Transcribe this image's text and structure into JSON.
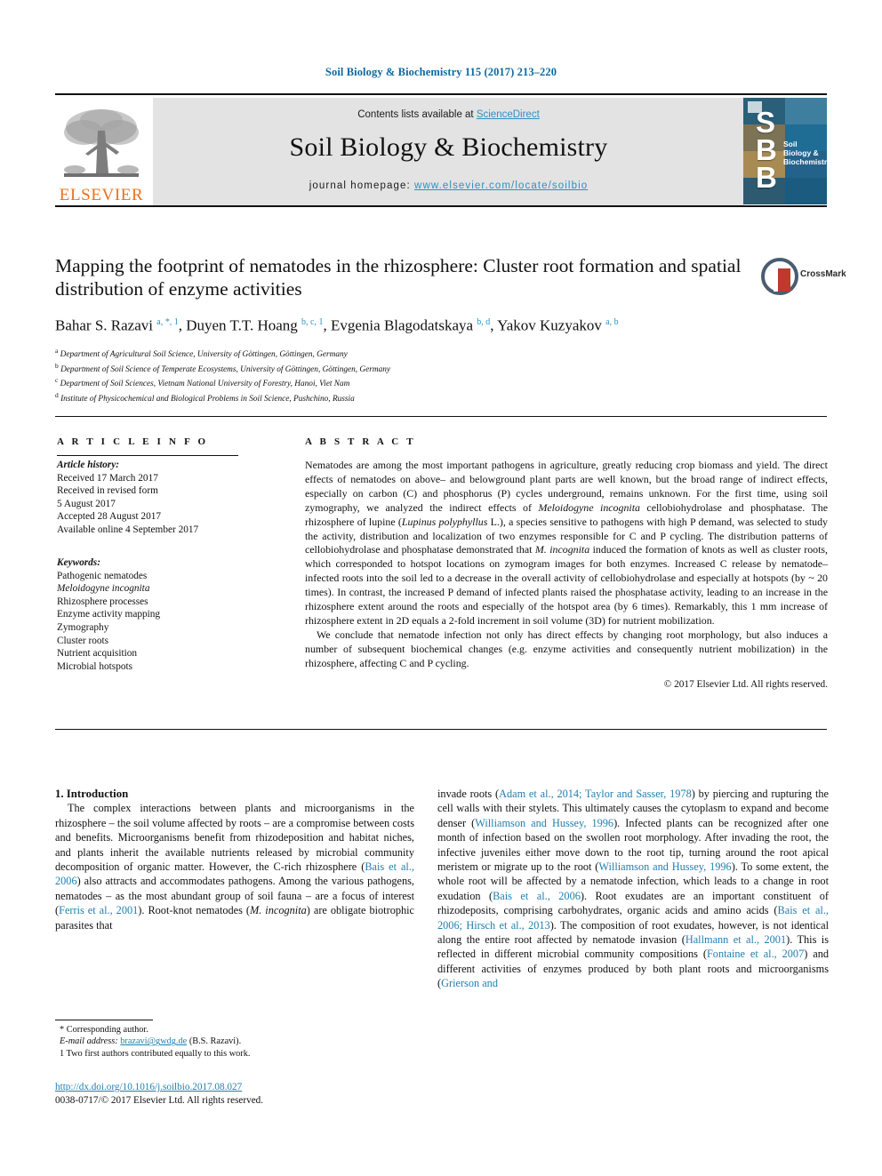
{
  "running_head": "Soil Biology & Biochemistry 115 (2017) 213–220",
  "masthead": {
    "contents_prefix": "Contents lists available at ",
    "sciencedirect": "ScienceDirect",
    "journal_title": "Soil Biology & Biochemistry",
    "homepage_label": "journal homepage: ",
    "homepage_url": "www.elsevier.com/locate/soilbio",
    "publisher": "ELSEVIER",
    "cover_initials": "S\nB\nB",
    "cover_name": "Soil Biology & Biochemistry",
    "accent_link_color": "#2e8fc4",
    "publisher_color": "#e9711c",
    "cover_bg_color": "#1d74a8"
  },
  "crossmark": {
    "label": "CrossMark"
  },
  "article": {
    "title": "Mapping the footprint of nematodes in the rhizosphere: Cluster root formation and spatial distribution of enzyme activities",
    "authors_html": "Bahar S. Razavi <sup>a, *, 1</sup>, Duyen T.T. Hoang <sup>b, c, 1</sup>, Evgenia Blagodatskaya <sup>b, d</sup>, Yakov Kuzyakov <sup>a, b</sup>",
    "affiliations": [
      {
        "mark": "a",
        "text": "Department of Agricultural Soil Science, University of Göttingen, Göttingen, Germany"
      },
      {
        "mark": "b",
        "text": "Department of Soil Science of Temperate Ecosystems, University of Göttingen, Göttingen, Germany"
      },
      {
        "mark": "c",
        "text": "Department of Soil Sciences, Vietnam National University of Forestry, Hanoi, Viet Nam"
      },
      {
        "mark": "d",
        "text": "Institute of Physicochemical and Biological Problems in Soil Science, Pushchino, Russia"
      }
    ]
  },
  "article_info": {
    "heading": "A R T I C L E   I N F O",
    "history_label": "Article history:",
    "history": [
      "Received 17 March 2017",
      "Received in revised form",
      "5 August 2017",
      "Accepted 28 August 2017",
      "Available online 4 September 2017"
    ],
    "keywords_label": "Keywords:",
    "keywords": [
      "Pathogenic nematodes",
      "Meloidogyne incognita",
      "Rhizosphere processes",
      "Enzyme activity mapping",
      "Zymography",
      "Cluster roots",
      "Nutrient acquisition",
      "Microbial hotspots"
    ],
    "keywords_italic_index": 1
  },
  "abstract": {
    "heading": "A B S T R A C T",
    "paragraph_1_html": "Nematodes are among the most important pathogens in agriculture, greatly reducing crop biomass and yield. The direct effects of nematodes on above– and belowground plant parts are well known, but the broad range of indirect effects, especially on carbon (C) and phosphorus (P) cycles underground, remains unknown. For the first time, using soil zymography, we analyzed the indirect effects of <span class=\"it\">Meloidogyne incognita</span> cellobiohydrolase and phosphatase. The rhizosphere of lupine (<span class=\"it\">Lupinus polyphyllus</span> L.), a species sensitive to pathogens with high P demand, was selected to study the activity, distribution and localization of two enzymes responsible for C and P cycling. The distribution patterns of cellobiohydrolase and phosphatase demonstrated that <span class=\"it\">M. incognita</span> induced the formation of knots as well as cluster roots, which corresponded to hotspot locations on zymogram images for both enzymes. Increased C release by nematode–infected roots into the soil led to a decrease in the overall activity of cellobiohydrolase and especially at hotspots (by ~ 20 times). In contrast, the increased P demand of infected plants raised the phosphatase activity, leading to an increase in the rhizosphere extent around the roots and especially of the hotspot area (by 6 times). Remarkably, this 1 mm increase of rhizosphere extent in 2D equals a 2-fold increment in soil volume (3D) for nutrient mobilization.",
    "paragraph_2_html": "We conclude that nematode infection not only has direct effects by changing root morphology, but also induces a number of subsequent biochemical changes (e.g. enzyme activities and consequently nutrient mobilization) in the rhizosphere, affecting C and P cycling.",
    "copyright": "© 2017 Elsevier Ltd. All rights reserved."
  },
  "body": {
    "section_heading": "1. Introduction",
    "left_paragraph_html": "The complex interactions between plants and microorganisms in the rhizosphere – the soil volume affected by roots – are a compromise between costs and benefits. Microorganisms benefit from rhizodeposition and habitat niches, and plants inherit the available nutrients released by microbial community decomposition of organic matter. However, the C-rich rhizosphere (<span class=\"ref\">Bais et al., 2006</span>) also attracts and accommodates pathogens. Among the various pathogens, nematodes – as the most abundant group of soil fauna – are a focus of interest (<span class=\"ref\">Ferris et al., 2001</span>). Root-knot nematodes (<span class=\"it\">M. incognita</span>) are obligate biotrophic parasites that",
    "right_paragraph_html": "invade roots (<span class=\"ref\">Adam et al., 2014; Taylor and Sasser, 1978</span>) by piercing and rupturing the cell walls with their stylets. This ultimately causes the cytoplasm to expand and become denser (<span class=\"ref\">Williamson and Hussey, 1996</span>). Infected plants can be recognized after one month of infection based on the swollen root morphology. After invading the root, the infective juveniles either move down to the root tip, turning around the root apical meristem or migrate up to the root (<span class=\"ref\">Williamson and Hussey, 1996</span>). To some extent, the whole root will be affected by a nematode infection, which leads to a change in root exudation (<span class=\"ref\">Bais et al., 2006</span>). Root exudates are an important constituent of rhizodeposits, comprising carbohydrates, organic acids and amino acids (<span class=\"ref\">Bais et al., 2006; Hirsch et al., 2013</span>). The composition of root exudates, however, is not identical along the entire root affected by nematode invasion (<span class=\"ref\">Hallmann et al., 2001</span>). This is reflected in different microbial community compositions (<span class=\"ref\">Fontaine et al., 2007</span>) and different activities of enzymes produced by both plant roots and microorganisms (<span class=\"ref\">Grierson and</span>",
    "reference_link_color": "#1f7fb0"
  },
  "footnotes": {
    "corresponding": "* Corresponding author.",
    "email_label": "E-mail address:",
    "email": "brazavi@gwdg.de",
    "email_suffix": "(B.S. Razavi).",
    "equal_contribution": "1  Two first authors contributed equally to this work."
  },
  "footer": {
    "doi": "http://dx.doi.org/10.1016/j.soilbio.2017.08.027",
    "issn_copyright": "0038-0717/© 2017 Elsevier Ltd. All rights reserved."
  }
}
